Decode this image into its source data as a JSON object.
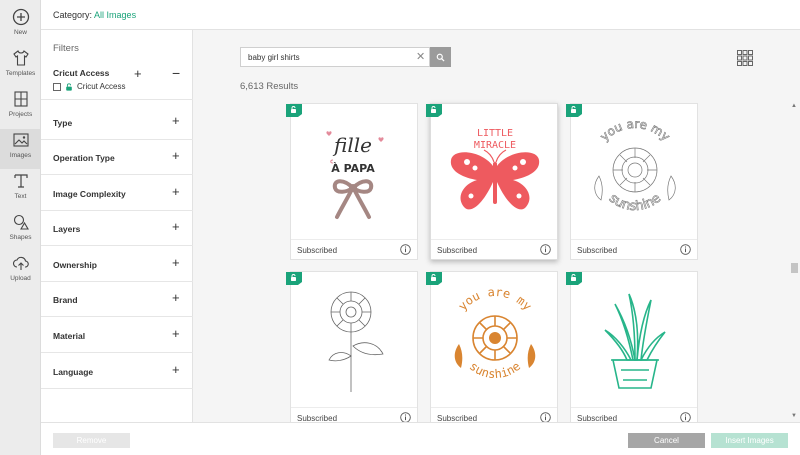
{
  "rail": [
    {
      "label": "New",
      "icon": "plus-circle-icon"
    },
    {
      "label": "Templates",
      "icon": "shirt-icon"
    },
    {
      "label": "Projects",
      "icon": "projects-icon"
    },
    {
      "label": "Images",
      "icon": "image-icon",
      "active": true
    },
    {
      "label": "Text",
      "icon": "text-icon"
    },
    {
      "label": "Shapes",
      "icon": "shapes-icon"
    },
    {
      "label": "Upload",
      "icon": "upload-icon"
    }
  ],
  "topbar": {
    "category_label": "Category:",
    "category_value": "All Images"
  },
  "filters": {
    "title": "Filters",
    "cricut_access": {
      "heading": "Cricut Access",
      "checkbox_label": "Cricut Access",
      "checked": false
    },
    "sections": [
      "Type",
      "Operation Type",
      "Image Complexity",
      "Layers",
      "Ownership",
      "Brand",
      "Material",
      "Language"
    ]
  },
  "search": {
    "value": "baby girl shirts",
    "placeholder": ""
  },
  "results": {
    "count_text": "6,613 Results"
  },
  "cards": [
    {
      "label": "Subscribed",
      "art": "fille-a-papa"
    },
    {
      "label": "Subscribed",
      "art": "little-miracle-butterfly"
    },
    {
      "label": "Subscribed",
      "art": "sunflower-sunshine-outline"
    },
    {
      "label": "Subscribed",
      "art": "sunflower-outline"
    },
    {
      "label": "Subscribed",
      "art": "sunflower-sunshine-orange"
    },
    {
      "label": "Subscribed",
      "art": "plant-pot"
    }
  ],
  "art_text": {
    "fille": "fille",
    "a_papa": "À PAPA",
    "little": "LITTLE",
    "miracle": "MIRACLE",
    "you_are_my": "you are my",
    "sunshine": "sunshine"
  },
  "footer": {
    "remove_label": "Remove",
    "cancel_label": "Cancel",
    "insert_label": "Insert Images"
  },
  "colors": {
    "accent": "#1aa37a",
    "badge": "#1aa37a",
    "butterfly": "#ee5a5f",
    "orange_art": "#d98531",
    "plant": "#27b58a",
    "bow": "#a58783",
    "cancel": "#a6a6a6",
    "insert_disabled": "#b6e2d2",
    "remove_disabled": "#e6e6e6"
  }
}
